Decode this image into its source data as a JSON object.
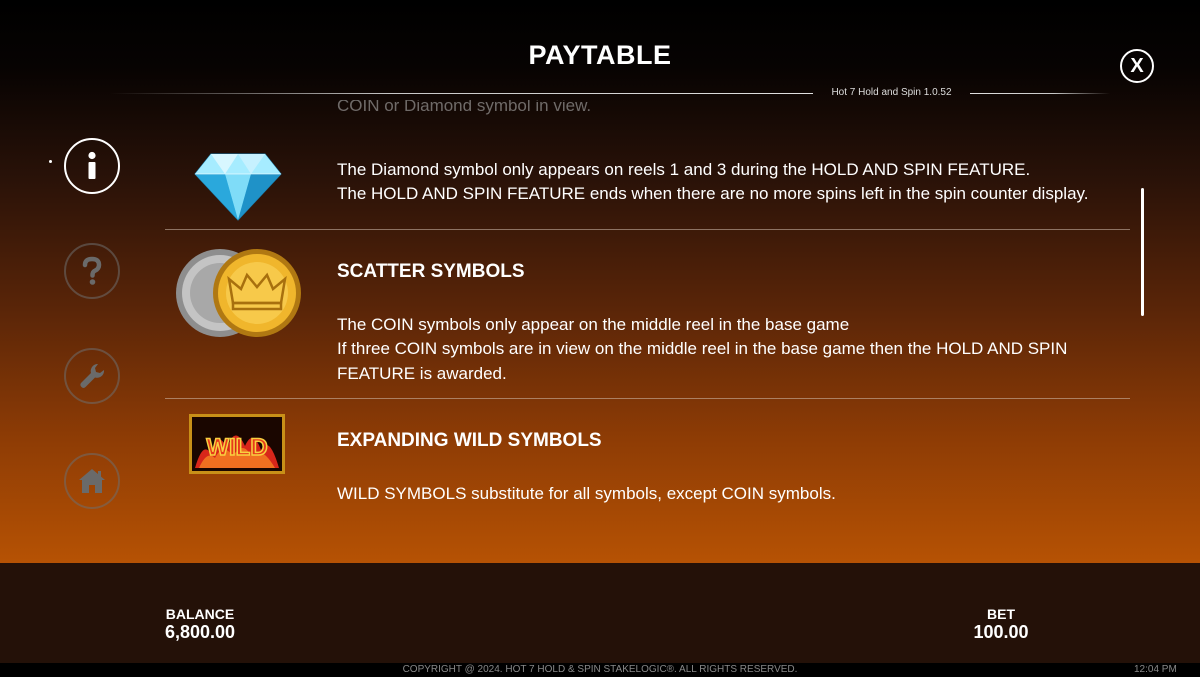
{
  "header": {
    "title": "PAYTABLE",
    "version": "Hot 7 Hold and Spin 1.0.52",
    "close_label": "X"
  },
  "nav": [
    {
      "name": "info",
      "icon": "info-icon",
      "active": true
    },
    {
      "name": "help",
      "icon": "question-icon",
      "active": false
    },
    {
      "name": "settings",
      "icon": "wrench-icon",
      "active": false
    },
    {
      "name": "home",
      "icon": "home-icon",
      "active": false
    }
  ],
  "content": {
    "cut_text": "COIN or Diamond symbol in view.",
    "diamond": {
      "icon": "diamond-icon",
      "line1": "The Diamond symbol only appears on reels 1 and 3 during the HOLD AND SPIN FEATURE.",
      "line2": "The HOLD AND SPIN FEATURE ends when there are no more spins left in the spin counter display."
    },
    "scatter": {
      "icon": "coin-icon",
      "heading": "SCATTER SYMBOLS",
      "line1": "The COIN symbols only appear on the middle reel in the base game",
      "line2": "If three COIN symbols are in view on the middle reel in the base game then the HOLD AND SPIN",
      "line3": "FEATURE is awarded."
    },
    "wild": {
      "icon": "wild-icon",
      "icon_text": "WILD",
      "heading": "EXPANDING WILD SYMBOLS",
      "line1": "WILD SYMBOLS substitute for all symbols, except COIN symbols."
    }
  },
  "footer": {
    "balance_label": "BALANCE",
    "balance_value": "6,800.00",
    "bet_label": "BET",
    "bet_value": "100.00",
    "copyright": "COPYRIGHT @ 2024. HOT 7 HOLD & SPIN STAKELOGIC®. ALL RIGHTS RESERVED.",
    "clock": "12:04 PM"
  },
  "colors": {
    "gradient_top": "#000000",
    "gradient_bottom": "#b65204",
    "footer_bg": "#241108",
    "diamond": "#4fd3f5",
    "coin_gold": "#e8b02a",
    "coin_silver": "#b8b8b8",
    "wild_red": "#d8261a"
  }
}
